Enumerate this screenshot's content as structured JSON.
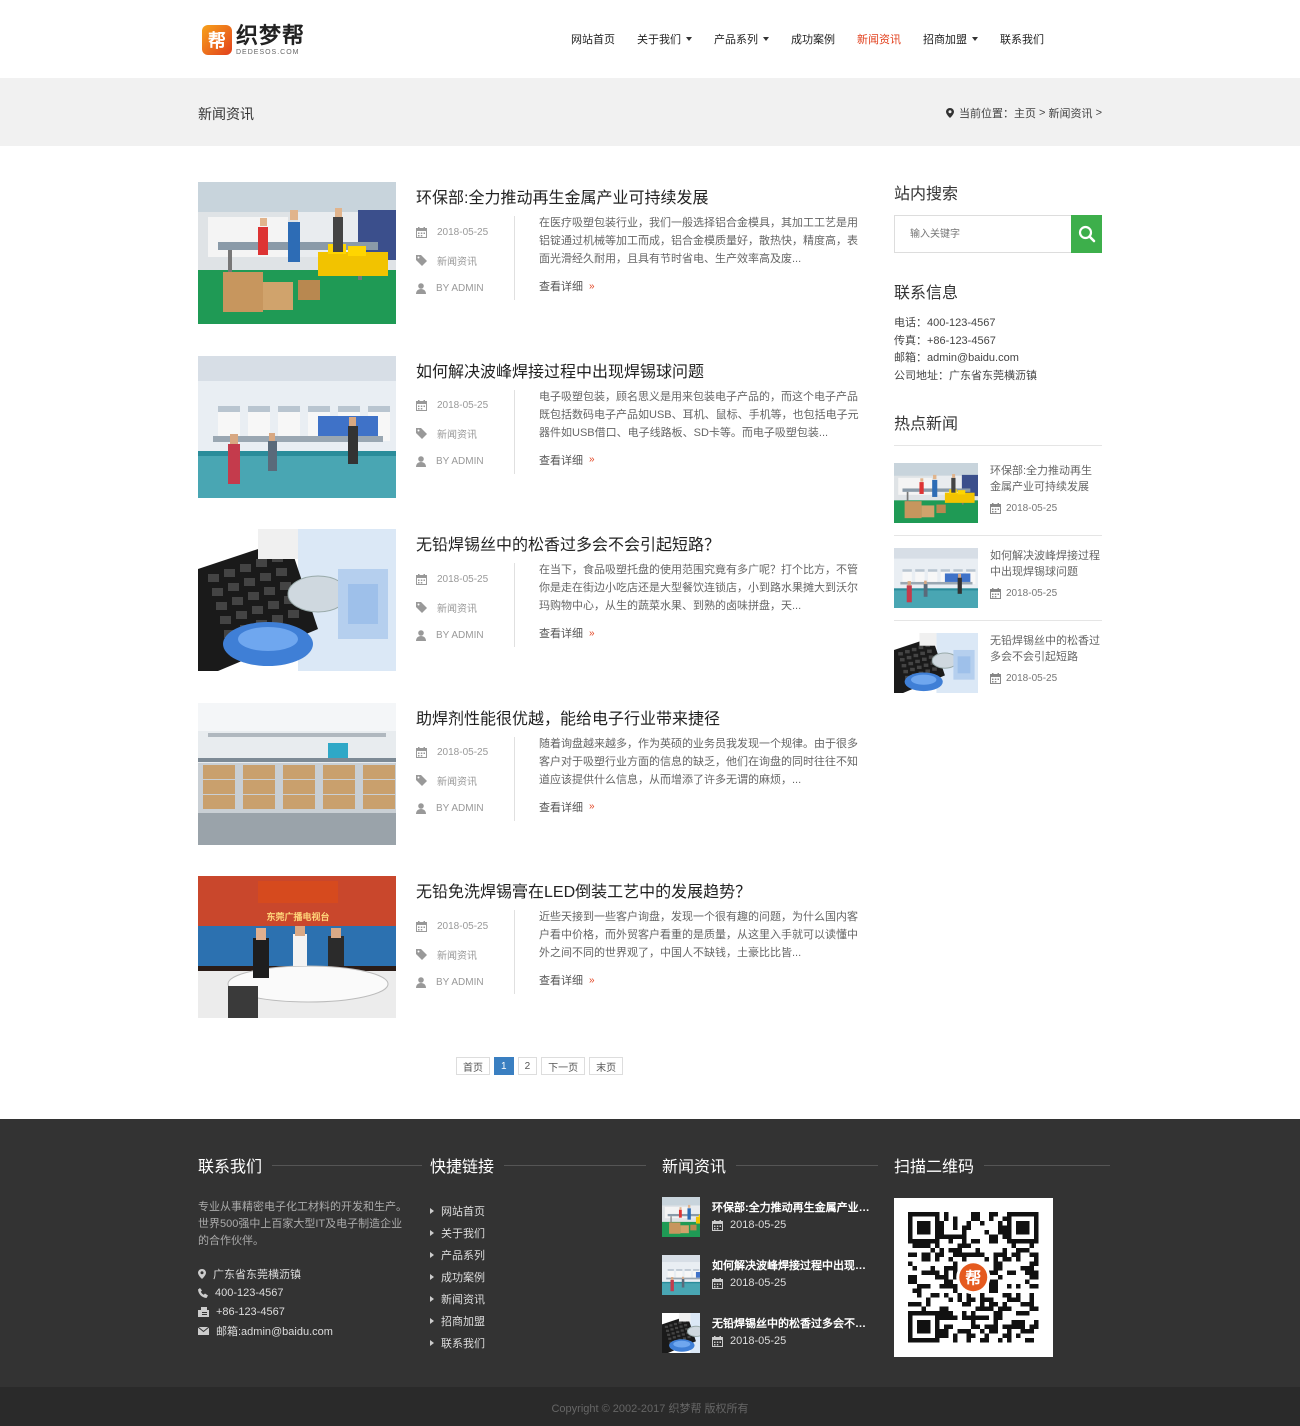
{
  "logo": {
    "badge": "帮",
    "name": "织梦帮",
    "domain": "DEDESOS.COM"
  },
  "nav": [
    {
      "label": "网站首页",
      "caret": false,
      "active": false
    },
    {
      "label": "关于我们",
      "caret": true,
      "active": false
    },
    {
      "label": "产品系列",
      "caret": true,
      "active": false
    },
    {
      "label": "成功案例",
      "caret": false,
      "active": false
    },
    {
      "label": "新闻资讯",
      "caret": false,
      "active": true
    },
    {
      "label": "招商加盟",
      "caret": true,
      "active": false
    },
    {
      "label": "联系我们",
      "caret": false,
      "active": false
    }
  ],
  "banner": {
    "title": "新闻资讯",
    "crumb_prefix": "当前位置：",
    "crumb_home": "主页",
    "crumb_sep": " > ",
    "crumb_current": "新闻资讯",
    "crumb_tail": " >"
  },
  "articles": [
    {
      "title": "环保部:全力推动再生金属产业可持续发展",
      "date": "2018-05-25",
      "category": "新闻资讯",
      "author": "BY ADMIN",
      "excerpt": "在医疗吸塑包装行业，我们一般选择铝合金模具，其加工工艺是用铝锭通过机械等加工而成，铝合金模质量好，散热快，精度高，表面光滑经久耐用，且具有节时省电、生产效率高及废...",
      "more": "查看详细",
      "thumb": "factory-line-photo"
    },
    {
      "title": "如何解决波峰焊接过程中出现焊锡球问题",
      "date": "2018-05-25",
      "category": "新闻资讯",
      "author": "BY ADMIN",
      "excerpt": "电子吸塑包装，顾名思义是用来包装电子产品的，而这个电子产品既包括数码电子产品如USB、耳机、鼠标、手机等，也包括电子元器件如USB借口、电子线路板、SD卡等。而电子吸塑包装...",
      "more": "查看详细",
      "thumb": "workshop-photo"
    },
    {
      "title": "无铅焊锡丝中的松香过多会不会引起短路？",
      "date": "2018-05-25",
      "category": "新闻资讯",
      "author": "BY ADMIN",
      "excerpt": "在当下，食品吸塑托盘的使用范围究竟有多广呢？打个比方，不管你是走在街边小吃店还是大型餐饮连锁店，小到路水果摊大到沃尔玛购物中心，从生的蔬菜水果、到熟的卤味拼盘，天...",
      "more": "查看详细",
      "thumb": "blister-trays-photo"
    },
    {
      "title": "助焊剂性能很优越，能给电子行业带来捷径",
      "date": "2018-05-25",
      "category": "新闻资讯",
      "author": "BY ADMIN",
      "excerpt": "随着询盘越来越多，作为英硕的业务员我发现一个规律。由于很多客户对于吸塑行业方面的信息的缺乏，他们在询盘的同时往往不知道应该提供什么信息，从而增添了许多无谓的麻烦，...",
      "more": "查看详细",
      "thumb": "warehouse-photo"
    },
    {
      "title": "无铅免洗焊锡膏在LED倒装工艺中的发展趋势？",
      "date": "2018-05-25",
      "category": "新闻资讯",
      "author": "BY ADMIN",
      "excerpt": "近些天接到一些客户询盘，发现一个很有趣的问题，为什么国内客户看中价格，而外贸客户看重的是质量，从这里入手就可以读懂中外之间不同的世界观了，中国人不缺钱，土豪比比皆...",
      "more": "查看详细",
      "thumb": "studio-photo",
      "thumb_sign": "东莞广播电视台"
    }
  ],
  "pager": {
    "first": "首页",
    "pages": [
      "1",
      "2"
    ],
    "current": "1",
    "next": "下一页",
    "last": "末页"
  },
  "sidebar": {
    "search_title": "站内搜索",
    "search_placeholder": "输入关键字",
    "contact_title": "联系信息",
    "contact": [
      "电话：400-123-4567",
      "传真：+86-123-4567",
      "邮箱：admin@baidu.com",
      "公司地址：广东省东莞横沥镇"
    ],
    "hot_title": "热点新闻",
    "hot": [
      {
        "title": "环保部:全力推动再生金属产业可持续发展",
        "date": "2018-05-25"
      },
      {
        "title": "如何解决波峰焊接过程中出现焊锡球问题",
        "date": "2018-05-25"
      },
      {
        "title": "无铅焊锡丝中的松香过多会不会引起短路",
        "date": "2018-05-25"
      }
    ]
  },
  "footer": {
    "contact_title": "联系我们",
    "about": "专业从事精密电子化工材料的开发和生产。世界500强中上百家大型IT及电子制造企业的合作伙伴。",
    "address": "广东省东莞横沥镇",
    "phone": "400-123-4567",
    "fax": "+86-123-4567",
    "email": "邮箱:admin@baidu.com",
    "links_title": "快捷链接",
    "links": [
      "网站首页",
      "关于我们",
      "产品系列",
      "成功案例",
      "新闻资讯",
      "招商加盟",
      "联系我们"
    ],
    "news_title": "新闻资讯",
    "news": [
      {
        "title": "环保部:全力推动再生金属产业可持续发展",
        "date": "2018-05-25"
      },
      {
        "title": "如何解决波峰焊接过程中出现焊锡球问题",
        "date": "2018-05-25"
      },
      {
        "title": "无铅焊锡丝中的松香过多会不会引起短路？",
        "date": "2018-05-25"
      }
    ],
    "qr_title": "扫描二维码",
    "qr_badge": "帮",
    "copyright": "Copyright © 2002-2017 织梦帮 版权所有"
  },
  "colors": {
    "accent": "#e2401d",
    "search_green": "#3daf4b",
    "pager_blue": "#3a7fc1",
    "footer_bg": "#333333"
  }
}
